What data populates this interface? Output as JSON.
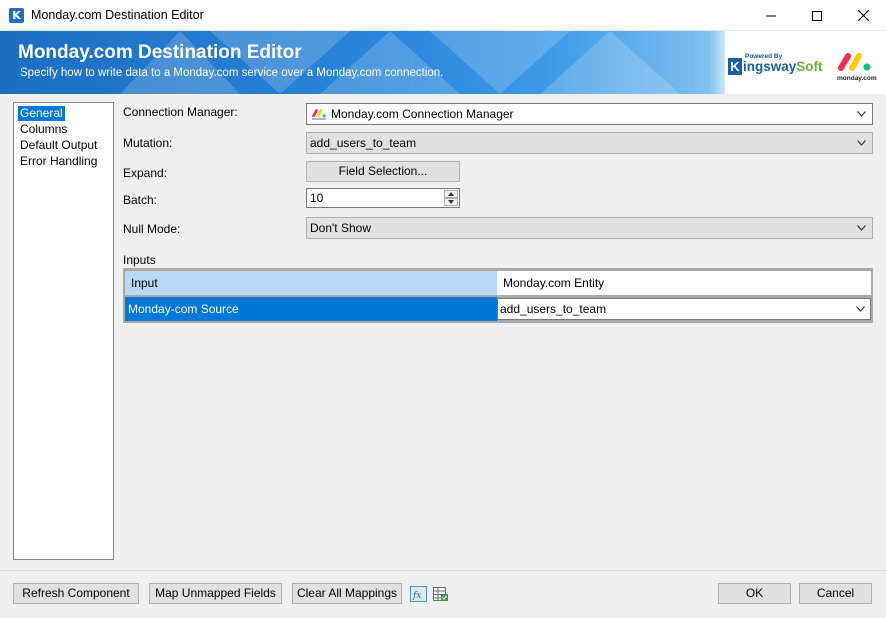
{
  "window": {
    "title": "Monday.com Destination Editor",
    "icon_letter": "K"
  },
  "banner": {
    "title": "Monday.com Destination Editor",
    "subtitle": "Specify how to write data to a Monday.com service over a Monday.com connection.",
    "kingsway_powered": "Powered By",
    "kingsway_k": "K",
    "kingsway_ingsway": "ingsway",
    "kingsway_soft": "Soft",
    "monday_logo_text": "monday.com"
  },
  "nav": {
    "items": [
      {
        "label": "General",
        "selected": true
      },
      {
        "label": "Columns",
        "selected": false
      },
      {
        "label": "Default Output",
        "selected": false
      },
      {
        "label": "Error Handling",
        "selected": false
      }
    ]
  },
  "form": {
    "connection_manager_label": "Connection Manager:",
    "connection_manager_value": "Monday.com Connection Manager",
    "mutation_label": "Mutation:",
    "mutation_value": "add_users_to_team",
    "expand_label": "Expand:",
    "field_selection_label": "Field Selection...",
    "batch_label": "Batch:",
    "batch_value": "10",
    "null_mode_label": "Null Mode:",
    "null_mode_value": "Don't Show",
    "inputs_label": "Inputs"
  },
  "inputs_grid": {
    "headers": [
      "Input",
      "Monday.com Entity"
    ],
    "rows": [
      {
        "input": "Monday-com Source",
        "entity": "add_users_to_team"
      }
    ]
  },
  "footer": {
    "refresh_label": "Refresh Component",
    "map_unmapped_label": "Map Unmapped Fields",
    "clear_mappings_label": "Clear All Mappings",
    "ok_label": "OK",
    "cancel_label": "Cancel"
  },
  "colors": {
    "accent": "#0078d7",
    "banner_blue": "#1b6ec2",
    "monday_red": "#f62b54",
    "monday_yellow": "#ffcc00",
    "monday_green": "#00ca72",
    "kingsway_green": "#6bb23a"
  },
  "icons": {
    "app": "kingsway-k-icon",
    "minimize": "minimize-icon",
    "maximize": "maximize-icon",
    "close": "close-icon",
    "dropdown": "chevron-down-icon",
    "expression": "fx-icon",
    "grid_export": "spreadsheet-icon"
  }
}
